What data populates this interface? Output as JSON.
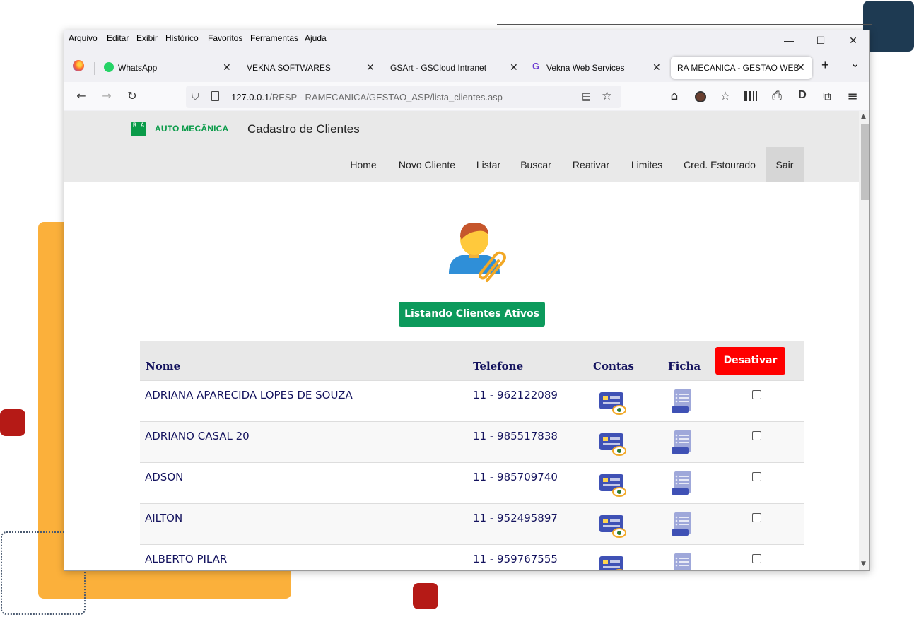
{
  "menu": [
    "Arquivo",
    "Editar",
    "Exibir",
    "Histórico",
    "Favoritos",
    "Ferramentas",
    "Ajuda"
  ],
  "window_controls": {
    "minimize": "—",
    "maximize": "☐",
    "close": "✕"
  },
  "tabs": [
    {
      "label": "WhatsApp",
      "icon": "whatsapp-icon",
      "active": false
    },
    {
      "label": "VEKNA SOFTWARES",
      "icon": "none",
      "active": false
    },
    {
      "label": "GSArt - GSCloud Intranet",
      "icon": "none",
      "active": false
    },
    {
      "label": "Vekna Web Services",
      "icon": "g-icon",
      "active": false
    },
    {
      "label": "RA MECANICA - GESTAO WEB",
      "icon": "none",
      "active": true
    }
  ],
  "tab_close": "✕",
  "new_tab": "+",
  "tab_list": "⌄",
  "url": {
    "host": "127.0.0.1",
    "path": "/RESP - RAMECANICA/GESTAO_ASP/lista_clientes.asp"
  },
  "nav_glyphs": {
    "back": "←",
    "forward": "→",
    "reload": "↻",
    "home": "⌂",
    "bookmark": "☆",
    "print": "⎙",
    "d": "D",
    "extensions": "⧉",
    "menu": "≡",
    "reader": "▤",
    "shield": "⛉"
  },
  "site": {
    "logo_letters": "R A",
    "logo_text": "AUTO MECÂNICA",
    "title": "Cadastro de Clientes",
    "nav": [
      "Home",
      "Novo Cliente",
      "Listar",
      "Buscar",
      "Reativar",
      "Limites",
      "Cred. Estourado",
      "Sair"
    ],
    "active_nav": "Sair"
  },
  "status_button": "Listando Clientes Ativos",
  "table": {
    "headers": {
      "nome": "Nome",
      "telefone": "Telefone",
      "contas": "Contas",
      "ficha": "Ficha"
    },
    "desativar_label": "Desativar",
    "rows": [
      {
        "nome": "ADRIANA APARECIDA LOPES DE SOUZA",
        "telefone": "11 - 962122089"
      },
      {
        "nome": "ADRIANO CASAL 20",
        "telefone": "11 - 985517838"
      },
      {
        "nome": "ADSON",
        "telefone": "11 - 985709740"
      },
      {
        "nome": "AILTON",
        "telefone": "11 - 952495897"
      },
      {
        "nome": "ALBERTO PILAR",
        "telefone": "11 - 959767555"
      }
    ]
  },
  "colors": {
    "accent_green": "#0c9a5c",
    "danger_red": "#ff0000",
    "text_navy": "#14135e",
    "logo_green": "#0a9b49"
  }
}
